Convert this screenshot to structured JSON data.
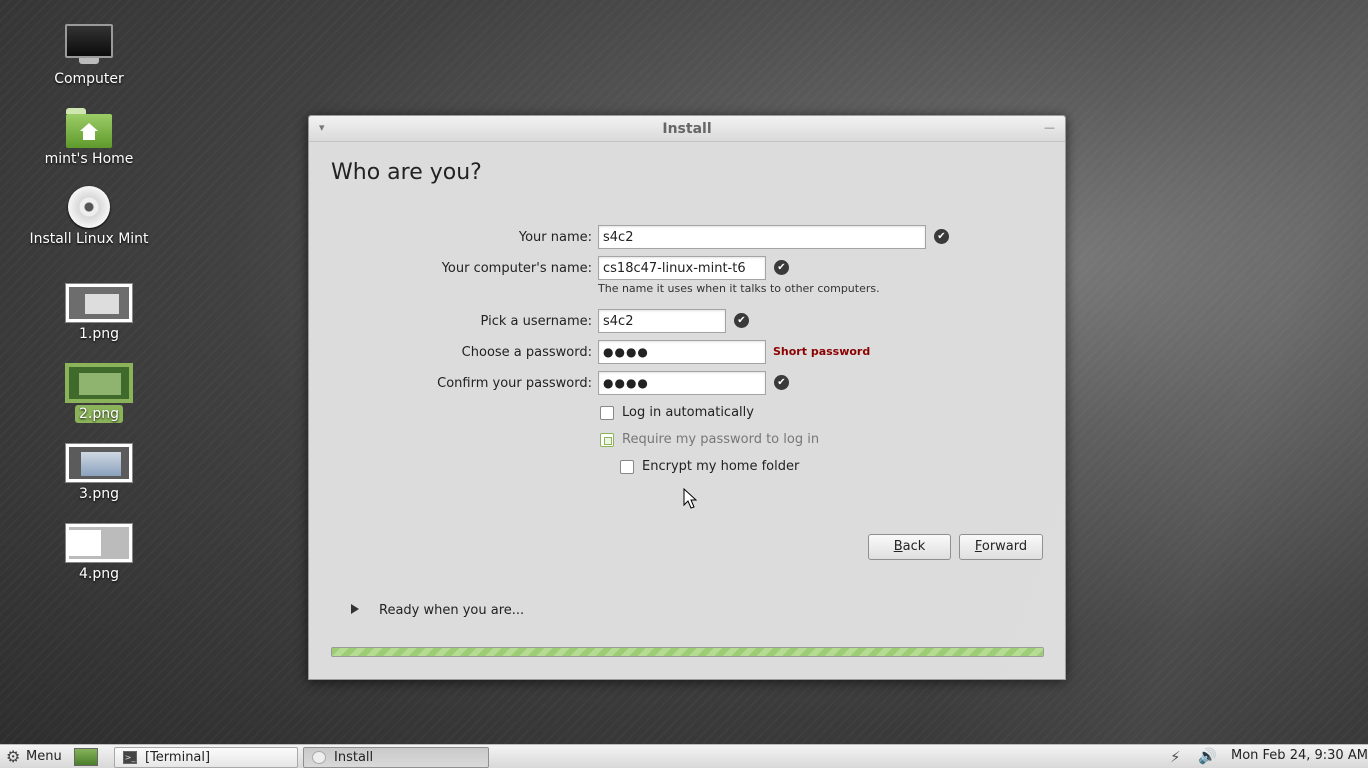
{
  "desktop": {
    "icons": [
      {
        "label": "Computer"
      },
      {
        "label": "mint's Home"
      },
      {
        "label": "Install Linux Mint"
      },
      {
        "label": "1.png"
      },
      {
        "label": "2.png"
      },
      {
        "label": "3.png"
      },
      {
        "label": "4.png"
      }
    ]
  },
  "window": {
    "title": "Install",
    "heading": "Who are you?",
    "form": {
      "name_label": "Your name:",
      "name_value": "s4c2",
      "computer_label": "Your computer's name:",
      "computer_value": "cs18c47-linux-mint-t6",
      "computer_hint": "The name it uses when it talks to other computers.",
      "username_label": "Pick a username:",
      "username_value": "s4c2",
      "password_label": "Choose a password:",
      "password_value": "●●●●",
      "password_warning": "Short password",
      "confirm_label": "Confirm your password:",
      "confirm_value": "●●●●"
    },
    "options": {
      "login_auto": "Log in automatically",
      "require_password": "Require my password to log in",
      "encrypt_home": "Encrypt my home folder"
    },
    "buttons": {
      "back_prefix": "",
      "back_mnemonic": "B",
      "back_rest": "ack",
      "forward_prefix": "",
      "forward_mnemonic": "F",
      "forward_rest": "orward"
    },
    "expander_label": "Ready when you are...",
    "progress": 1.0
  },
  "taskbar": {
    "menu_label": "Menu",
    "tasks": [
      {
        "label": "[Terminal]"
      },
      {
        "label": "Install"
      }
    ],
    "clock": "Mon Feb 24,  9:30 AM"
  },
  "colors": {
    "accent": "#8bb45a",
    "warning": "#8b0000"
  },
  "icons": [
    "gear-icon",
    "terminal-icon",
    "network-icon",
    "volume-icon",
    "check-icon"
  ]
}
